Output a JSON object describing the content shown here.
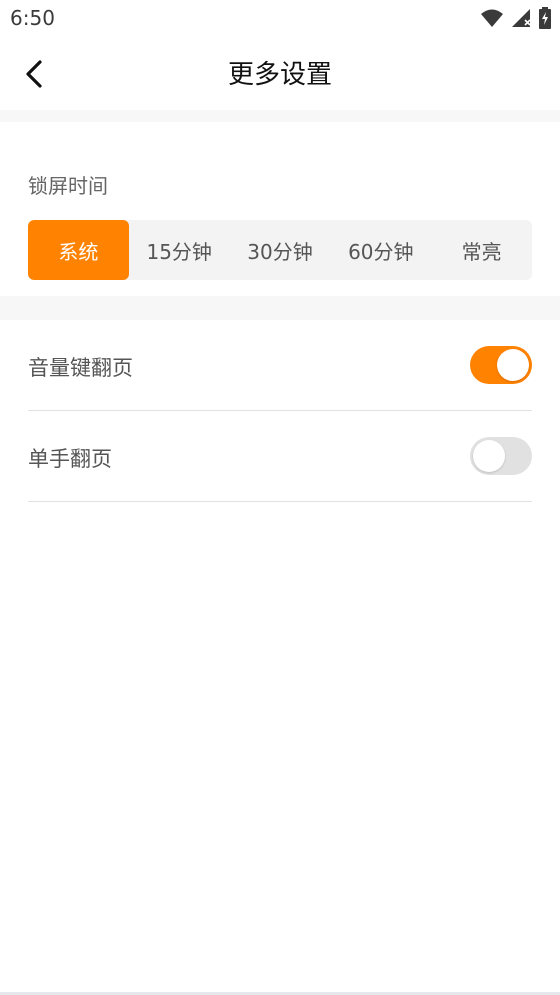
{
  "status_bar": {
    "time": "6:50",
    "icons": [
      "wifi-icon",
      "signal-icon",
      "battery-charging-icon"
    ]
  },
  "header": {
    "title": "更多设置",
    "back_icon": "chevron-left-icon"
  },
  "lock_screen": {
    "label": "锁屏时间",
    "options": [
      "系统",
      "15分钟",
      "30分钟",
      "60分钟",
      "常亮"
    ],
    "selected": "系统"
  },
  "settings": [
    {
      "label": "音量键翻页",
      "enabled": true
    },
    {
      "label": "单手翻页",
      "enabled": false
    }
  ],
  "colors": {
    "accent": "#ff8200",
    "toggle_off": "#e1e1e1",
    "segment_bg": "#f3f3f3"
  }
}
